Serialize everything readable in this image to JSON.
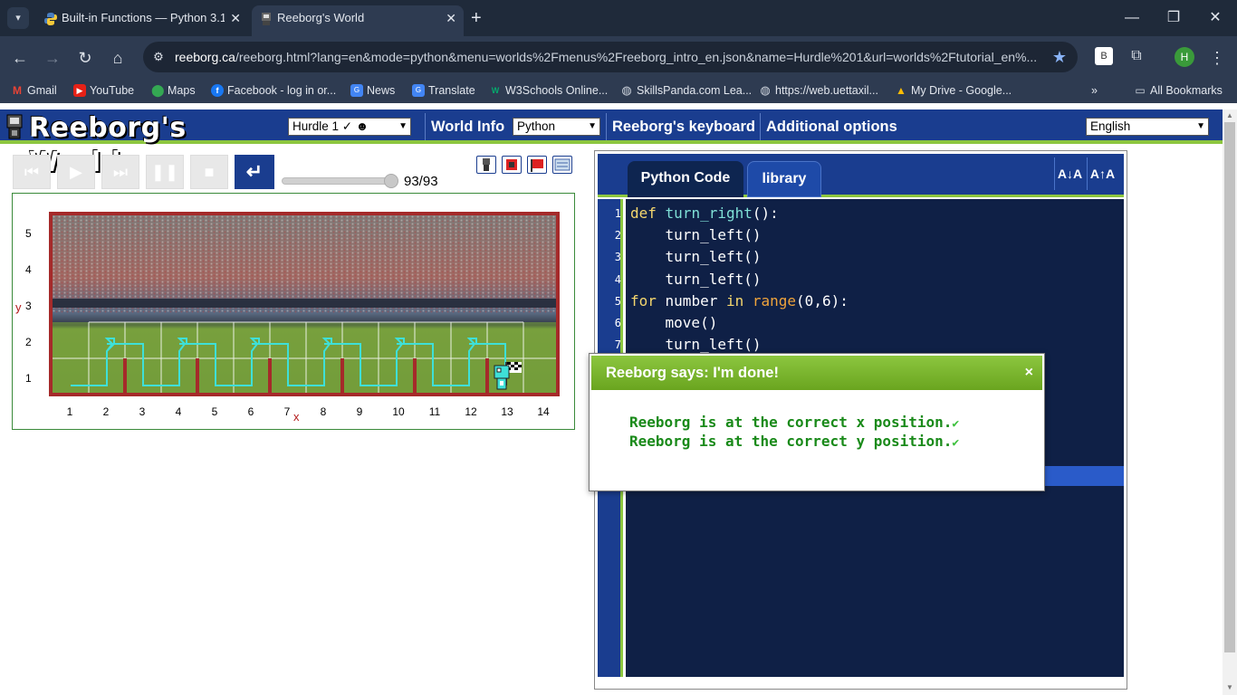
{
  "browser": {
    "tabs": [
      {
        "label": "Built-in Functions — Python 3.1",
        "active": false
      },
      {
        "label": "Reeborg's World",
        "active": true
      }
    ],
    "url_host": "reeborg.ca",
    "url_rest": "/reeborg.html?lang=en&mode=python&menu=worlds%2Fmenus%2Freeborg_intro_en.json&name=Hurdle%201&url=worlds%2Ftutorial_en%...",
    "profile_initial": "H",
    "bookmarks": [
      {
        "label": "Gmail",
        "icon": "gmail-icon"
      },
      {
        "label": "YouTube",
        "icon": "youtube-icon"
      },
      {
        "label": "Maps",
        "icon": "maps-icon"
      },
      {
        "label": "Facebook - log in or...",
        "icon": "facebook-icon"
      },
      {
        "label": "News",
        "icon": "news-icon"
      },
      {
        "label": "Translate",
        "icon": "translate-icon"
      },
      {
        "label": "W3Schools Online...",
        "icon": "w3schools-icon"
      },
      {
        "label": "SkillsPanda.com Lea...",
        "icon": "globe-icon"
      },
      {
        "label": "https://web.uettaxil...",
        "icon": "globe-icon"
      },
      {
        "label": "My Drive - Google...",
        "icon": "drive-icon"
      }
    ],
    "all_bookmarks": "All Bookmarks"
  },
  "app": {
    "title": "Reeborg's World",
    "world_select": "Hurdle 1 ✓",
    "world_info": "World Info",
    "mode_select": "Python",
    "keyboard": "Reeborg's keyboard",
    "additional_options": "Additional options",
    "language_select": "English"
  },
  "controls": {
    "step_count": "93/93",
    "progress_fraction": 1.0
  },
  "world": {
    "x_labels": [
      "1",
      "2",
      "3",
      "4",
      "5",
      "6",
      "7",
      "8",
      "9",
      "10",
      "11",
      "12",
      "13",
      "14"
    ],
    "y_labels": [
      "5",
      "4",
      "3",
      "2",
      "1"
    ],
    "x_axis": "x",
    "y_axis": "y"
  },
  "editor": {
    "tab_code": "Python Code",
    "tab_library": "library",
    "font_decrease": "A↓A",
    "font_increase": "A↑A",
    "line_numbers": [
      "1",
      "2",
      "3",
      "4",
      "5",
      "6",
      "7"
    ]
  },
  "dialog": {
    "title": "Reeborg says: I'm done!",
    "close": "×",
    "messages": [
      "Reeborg is at the correct x position.",
      "Reeborg is at the correct y position."
    ]
  },
  "colors": {
    "header_blue": "#1a3d8f",
    "accent_green": "#8cc63f",
    "editor_bg": "#0f2046",
    "wall_red": "#a52a2a"
  }
}
